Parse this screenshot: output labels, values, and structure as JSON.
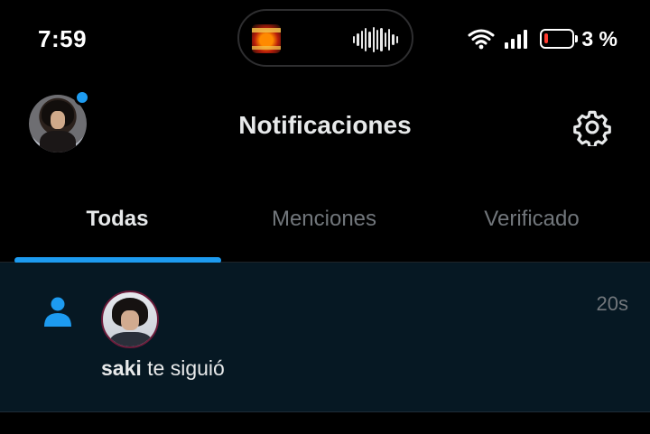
{
  "status_bar": {
    "time": "7:59",
    "battery_percent": "3 %",
    "battery_level": 0.03,
    "icons": [
      "wifi-icon",
      "signal-icon",
      "battery-icon"
    ],
    "media_indicator": {
      "album_art": "album-art-thumbnail",
      "waveform": "audio-waveform-icon"
    }
  },
  "header": {
    "title": "Notificaciones",
    "has_unread_dot": true,
    "settings_icon": "gear-icon"
  },
  "tabs": [
    {
      "label": "Todas",
      "active": true
    },
    {
      "label": "Menciones",
      "active": false
    },
    {
      "label": "Verificado",
      "active": false
    }
  ],
  "notifications": [
    {
      "type_icon": "person-follow-icon",
      "username": "saki",
      "action": " te siguió",
      "time": "20s"
    }
  ],
  "colors": {
    "background": "#000000",
    "accent": "#1d9bf0",
    "text_primary": "#e7e9ea",
    "text_secondary": "#71767b",
    "notification_bg": "#061823",
    "battery_low": "#ff3b30"
  }
}
